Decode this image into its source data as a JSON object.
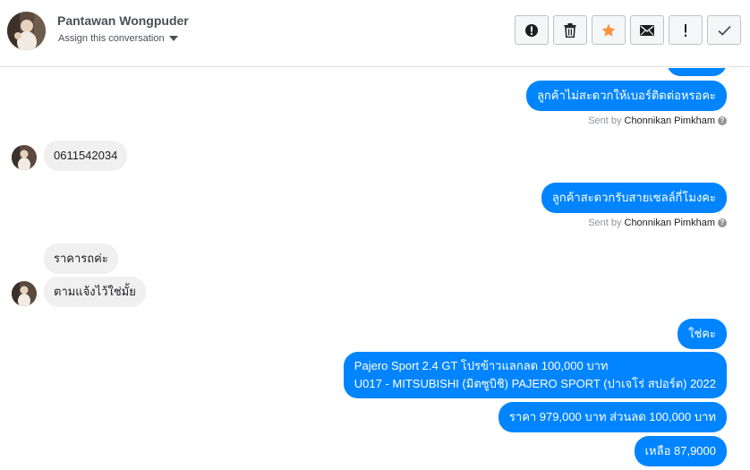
{
  "header": {
    "contact_name": "Pantawan Wongpuder",
    "assign_label": "Assign this conversation"
  },
  "toolbar": {
    "buttons": [
      {
        "icon": "alert-circle-icon"
      },
      {
        "icon": "trash-icon"
      },
      {
        "icon": "star-icon",
        "color": "#f7923a"
      },
      {
        "icon": "envelope-icon"
      },
      {
        "icon": "exclamation-icon"
      },
      {
        "icon": "checkmark-icon"
      }
    ]
  },
  "sent_by_prefix": "Sent by",
  "messages": [
    {
      "direction": "out",
      "text": "ลูกค้าไม่สะดวกให้เบอร์ติดต่อหรอคะ",
      "sender": "Chonnikan Pimkham"
    },
    {
      "direction": "in",
      "text": "0611542034"
    },
    {
      "direction": "out",
      "text": "ลูกค้าสะดวกรับสายเซลล์กี่โมงคะ",
      "sender": "Chonnikan Pimkham"
    },
    {
      "direction": "in",
      "text": "ราคารถค่ะ"
    },
    {
      "direction": "in",
      "text": "ตามแจ้งไว้ใช่มั้ย"
    },
    {
      "direction": "out",
      "text": "ใช่คะ"
    },
    {
      "direction": "out",
      "lines": [
        "Pajero Sport 2.4 GT โปรข้าวแลกลด 100,000 บาท",
        "U017 - MITSUBISHI (มิตซูบิชิ) PAJERO SPORT (ปาเจโร่ สปอร์ต) 2022"
      ]
    },
    {
      "direction": "out",
      "text": "ราคา 979,000 บาท ส่วนลด 100,000 บาท"
    },
    {
      "direction": "out",
      "text": "เหลือ 87,9000"
    }
  ],
  "colors": {
    "outgoing_bubble": "#0084ff",
    "incoming_bubble": "#f1f0f0",
    "star": "#f7923a"
  }
}
